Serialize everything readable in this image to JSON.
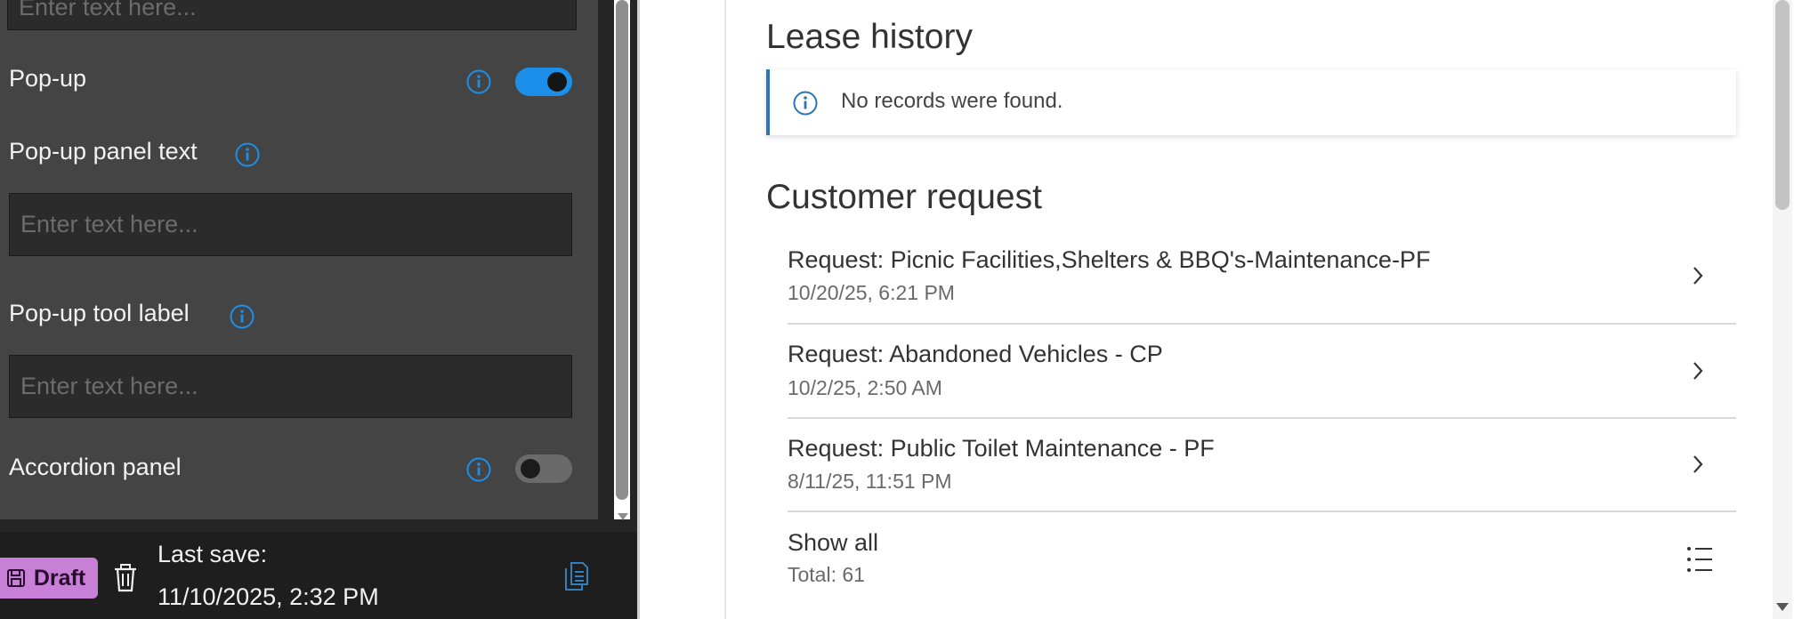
{
  "config": {
    "top_input_placeholder": "Enter text here...",
    "popup_label": "Pop-up",
    "popup_toggle_on": true,
    "popup_panel_text_label": "Pop-up panel text",
    "popup_panel_text_placeholder": "Enter text here...",
    "popup_tool_label": "Pop-up tool label",
    "popup_tool_placeholder": "Enter text here...",
    "accordion_label": "Accordion panel",
    "accordion_toggle_on": false
  },
  "bottom": {
    "draft_label": "Draft",
    "last_save_label": "Last save:",
    "last_save_value": "11/10/2025, 2:32 PM"
  },
  "viewer": {
    "lease_history_title": "Lease history",
    "no_records": "No records were found.",
    "customer_request_title": "Customer request",
    "requests": [
      {
        "title": "Request: Picnic Facilities,Shelters & BBQ's-Maintenance-PF",
        "date": "10/20/25, 6:21 PM"
      },
      {
        "title": "Request: Abandoned Vehicles - CP",
        "date": "10/2/25, 2:50 AM"
      },
      {
        "title": "Request: Public Toilet Maintenance - PF",
        "date": "8/11/25, 11:51 PM"
      }
    ],
    "show_all_label": "Show all",
    "total_label": "Total: 61"
  },
  "colors": {
    "accent": "#1b8fea",
    "draft": "#c880d6",
    "panel": "#444444",
    "notice_border": "#2a75b8"
  },
  "icons": [
    "info-icon",
    "save-icon",
    "trash-icon",
    "copy-icon",
    "chevron-right-icon",
    "list-icon"
  ]
}
